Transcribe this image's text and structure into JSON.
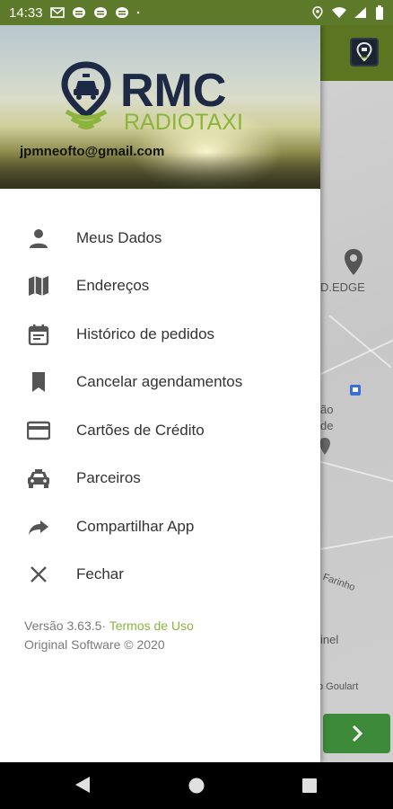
{
  "status_bar": {
    "time": "14:33",
    "left_icons": [
      "mail-icon",
      "chat-bubble-icon",
      "chat-bubble-icon",
      "chat-bubble-icon",
      "dot-icon"
    ],
    "right_icons": [
      "location-icon",
      "wifi-icon",
      "signal-icon",
      "battery-icon"
    ]
  },
  "drawer": {
    "logo": {
      "name": "RMC",
      "subtitle": "RADIOTAXI"
    },
    "user_email": "jpmneofto@gmail.com",
    "menu": [
      {
        "label": "Meus Dados",
        "icon": "person-icon"
      },
      {
        "label": "Endereços",
        "icon": "map-icon"
      },
      {
        "label": "Histórico de pedidos",
        "icon": "calendar-icon"
      },
      {
        "label": "Cancelar agendamentos",
        "icon": "bookmark-icon"
      },
      {
        "label": "Cartões de Crédito",
        "icon": "credit-card-icon"
      },
      {
        "label": "Parceiros",
        "icon": "taxi-icon"
      },
      {
        "label": "Compartilhar App",
        "icon": "share-icon"
      },
      {
        "label": "Fechar",
        "icon": "close-icon"
      }
    ],
    "footer": {
      "version": "Versão 3.63.5·",
      "terms_link": "Termos de Uso",
      "copyright": "Original Software © 2020"
    }
  },
  "background_map": {
    "labels": [
      "D.EDGE",
      "ão",
      "de",
      "Farinho",
      "inel",
      "o Goulart"
    ]
  },
  "colors": {
    "accent_green": "#8ab43c",
    "toolbar_green": "#5b7520",
    "logo_navy": "#1e2a45"
  },
  "nav_bar": {
    "buttons": [
      "back",
      "home",
      "recents"
    ]
  }
}
